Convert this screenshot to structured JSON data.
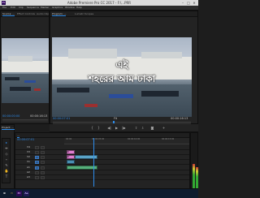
{
  "titlebar": {
    "app_icon": "Pr",
    "title": "Adobe Premiere Pro CC 2017 - F:\\...PRR",
    "minimize": "–",
    "maximize": "□",
    "close": "✕"
  },
  "menubar": {
    "items": [
      "File",
      "Edit",
      "Clip",
      "Sequence",
      "Marker",
      "Graphics",
      "Window",
      "Help"
    ]
  },
  "source_panel": {
    "tabs": [
      "Source: ...",
      "Effect Controls",
      "Audio Clip Mixer: ..."
    ],
    "timecode_left": "00:00:00:00",
    "timecode_right": "00:00:16:13"
  },
  "program_panel": {
    "tabs": [
      "Program: ...",
      "Lumetri Scopes"
    ],
    "caption_line1": "এই",
    "caption_line2": "শহরের আম ঢাকা",
    "timecode": "00:00:07:01",
    "fit": "Fit",
    "duration": "00:00:16:13"
  },
  "left_lower": {
    "tabs": [
      "Project: ...",
      "Media Browser"
    ]
  },
  "timeline": {
    "tab": "...",
    "timecode": "00:00:07:01",
    "ruler_labels": [
      "00:00",
      "00:00:05:00",
      "00:00:10:00",
      "00:00:15:00"
    ],
    "tracks": [
      {
        "name": "V4"
      },
      {
        "name": "V3"
      },
      {
        "name": "V2"
      },
      {
        "name": "V1"
      },
      {
        "name": "A1"
      },
      {
        "name": "A2"
      },
      {
        "name": "A3"
      }
    ],
    "clips": [
      {
        "label": "fx",
        "color": "#e17fd1"
      },
      {
        "label": "fx",
        "color": "#e17fd1"
      },
      {
        "label": "",
        "color": "#5aa3c7"
      },
      {
        "label": "",
        "color": "#4a8fb3"
      },
      {
        "label": "",
        "color": "#56b07b"
      }
    ]
  },
  "controls": {
    "mark_in": "{",
    "mark_out": "}",
    "step_back": "◀|",
    "play": "▶",
    "step_fwd": "|▶",
    "lift": "⇧",
    "extract": "⇩",
    "camera": "◙",
    "add": "+"
  },
  "tools": [
    "▸",
    "⇹",
    "◇",
    "⌁",
    "✎",
    "✋",
    "T"
  ],
  "taskbar": {
    "icons": [
      {
        "name": "start",
        "glyph": "⊞",
        "color": "#ffffff",
        "bg": "#0e1c2e"
      },
      {
        "name": "explorer",
        "glyph": "▭",
        "color": "#f2c94c",
        "bg": "#0e1c2e"
      },
      {
        "name": "premiere",
        "glyph": "Pr",
        "color": "#e3a8ff",
        "bg": "#2a0c52"
      },
      {
        "name": "after-effects",
        "glyph": "Ae",
        "color": "#c9b8ff",
        "bg": "#1e1a50"
      }
    ]
  },
  "colors": {
    "accent": "#2d8ceb",
    "clip_pink": "#e17fd1",
    "clip_blue": "#5aa3c7",
    "clip_green": "#56b07b"
  }
}
